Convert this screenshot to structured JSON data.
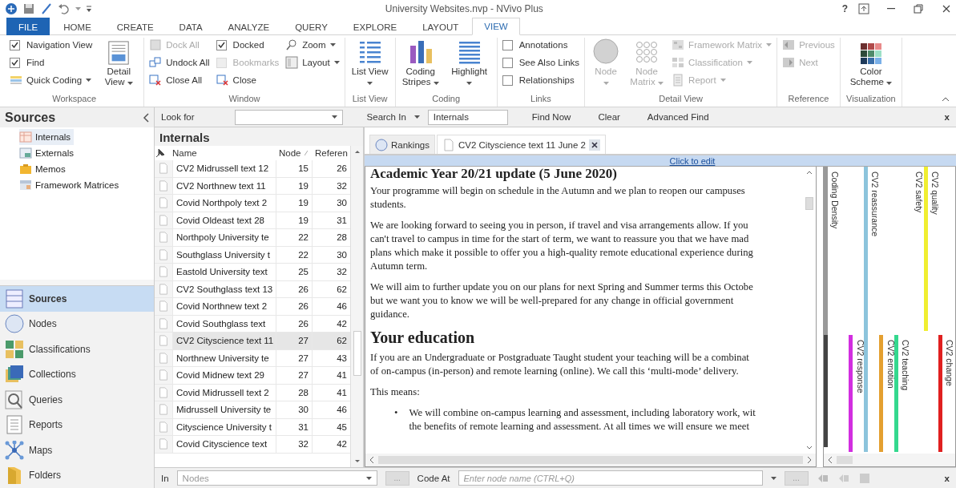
{
  "window": {
    "title": "University Websites.nvp - NVivo Plus",
    "help_button": "?"
  },
  "ribbon_tabs": [
    {
      "label": "FILE",
      "kind": "file",
      "selected": false
    },
    {
      "label": "HOME",
      "kind": "tab",
      "selected": false
    },
    {
      "label": "CREATE",
      "kind": "tab",
      "selected": false
    },
    {
      "label": "DATA",
      "kind": "tab",
      "selected": false
    },
    {
      "label": "ANALYZE",
      "kind": "tab",
      "selected": false
    },
    {
      "label": "QUERY",
      "kind": "tab",
      "selected": false
    },
    {
      "label": "EXPLORE",
      "kind": "tab",
      "selected": false
    },
    {
      "label": "LAYOUT",
      "kind": "tab",
      "selected": false
    },
    {
      "label": "VIEW",
      "kind": "tab",
      "selected": true
    }
  ],
  "ribbon_groups": [
    {
      "label": "Workspace",
      "columns": [
        [
          {
            "kind": "check",
            "label": "Navigation View",
            "checked": true,
            "disabled": false
          },
          {
            "kind": "check",
            "label": "Find",
            "checked": true,
            "disabled": false
          },
          {
            "kind": "small",
            "label": "Quick Coding",
            "dropdown": true,
            "disabled": false
          }
        ],
        [
          {
            "kind": "large",
            "label": "Detail View",
            "dropdown": true,
            "disabled": false
          }
        ]
      ]
    },
    {
      "label": "Window",
      "columns": [
        [
          {
            "kind": "small",
            "label": "Dock All",
            "dropdown": false,
            "disabled": true
          },
          {
            "kind": "small",
            "label": "Undock All",
            "dropdown": false,
            "disabled": false
          },
          {
            "kind": "small",
            "label": "Close All",
            "dropdown": false,
            "disabled": false
          }
        ],
        [
          {
            "kind": "check",
            "label": "Docked",
            "checked": true,
            "disabled": false
          },
          {
            "kind": "check",
            "label": "Bookmarks",
            "checked": false,
            "disabled": true
          },
          {
            "kind": "small",
            "label": "Close",
            "dropdown": false,
            "disabled": false
          }
        ],
        [
          {
            "kind": "small",
            "label": "Zoom",
            "dropdown": true,
            "disabled": false
          },
          {
            "kind": "small",
            "label": "Layout",
            "dropdown": true,
            "disabled": false
          }
        ]
      ]
    },
    {
      "label": "List View",
      "columns": [
        [
          {
            "kind": "large",
            "label": "List View",
            "dropdown": true,
            "disabled": false
          }
        ]
      ]
    },
    {
      "label": "Coding",
      "columns": [
        [
          {
            "kind": "large",
            "label": "Coding Stripes",
            "dropdown": true,
            "disabled": false
          }
        ],
        [
          {
            "kind": "large",
            "label": "Highlight",
            "dropdown": true,
            "disabled": false
          }
        ]
      ]
    },
    {
      "label": "Links",
      "columns": [
        [
          {
            "kind": "check",
            "label": "Annotations",
            "checked": false,
            "disabled": false
          },
          {
            "kind": "check",
            "label": "See Also Links",
            "checked": false,
            "disabled": false
          },
          {
            "kind": "check",
            "label": "Relationships",
            "checked": false,
            "disabled": false
          }
        ]
      ]
    },
    {
      "label": "Detail View",
      "columns": [
        [
          {
            "kind": "large",
            "label": "Node",
            "dropdown": true,
            "disabled": true
          }
        ],
        [
          {
            "kind": "large",
            "label": "Node Matrix",
            "dropdown": true,
            "disabled": true
          }
        ],
        [
          {
            "kind": "small",
            "label": "Framework Matrix",
            "dropdown": true,
            "disabled": true
          },
          {
            "kind": "small",
            "label": "Classification",
            "dropdown": true,
            "disabled": true
          },
          {
            "kind": "small",
            "label": "Report",
            "dropdown": true,
            "disabled": true
          }
        ]
      ]
    },
    {
      "label": "Reference",
      "columns": [
        [
          {
            "kind": "small",
            "label": "Previous",
            "dropdown": false,
            "disabled": true
          },
          {
            "kind": "small",
            "label": "Next",
            "dropdown": false,
            "disabled": true
          }
        ]
      ]
    },
    {
      "label": "Visualization",
      "columns": [
        [
          {
            "kind": "large",
            "label": "Color Scheme",
            "dropdown": true,
            "disabled": false
          }
        ]
      ]
    }
  ],
  "navigation": {
    "title": "Sources",
    "tree": [
      {
        "label": "Internals",
        "selected": true
      },
      {
        "label": "Externals",
        "selected": false
      },
      {
        "label": "Memos",
        "selected": false
      },
      {
        "label": "Framework Matrices",
        "selected": false
      }
    ],
    "buttons": [
      {
        "label": "Sources",
        "selected": true
      },
      {
        "label": "Nodes",
        "selected": false
      },
      {
        "label": "Classifications",
        "selected": false
      },
      {
        "label": "Collections",
        "selected": false
      },
      {
        "label": "Queries",
        "selected": false
      },
      {
        "label": "Reports",
        "selected": false
      },
      {
        "label": "Maps",
        "selected": false
      },
      {
        "label": "Folders",
        "selected": false
      }
    ]
  },
  "find_bar": {
    "look_for_label": "Look for",
    "search_in_label": "Search In",
    "search_in_value": "Internals",
    "find_now": "Find Now",
    "clear": "Clear",
    "advanced_find": "Advanced Find",
    "close": "x"
  },
  "list": {
    "title": "Internals",
    "columns": [
      "Name",
      "Node",
      "Referen"
    ],
    "rows": [
      {
        "name": "CV2 Midrussell text 12",
        "nodes": "15",
        "references": "26",
        "selected": false
      },
      {
        "name": "CV2 Northnew text 11",
        "nodes": "19",
        "references": "32",
        "selected": false
      },
      {
        "name": "Covid Northpoly text 2",
        "nodes": "19",
        "references": "30",
        "selected": false
      },
      {
        "name": "Covid Oldeast text 28",
        "nodes": "19",
        "references": "31",
        "selected": false
      },
      {
        "name": "Northpoly University te",
        "nodes": "22",
        "references": "28",
        "selected": false
      },
      {
        "name": "Southglass University t",
        "nodes": "22",
        "references": "30",
        "selected": false
      },
      {
        "name": "Eastold University text",
        "nodes": "25",
        "references": "32",
        "selected": false
      },
      {
        "name": "CV2 Southglass text 13",
        "nodes": "26",
        "references": "62",
        "selected": false
      },
      {
        "name": "Covid Northnew text 2",
        "nodes": "26",
        "references": "46",
        "selected": false
      },
      {
        "name": "Covid Southglass text",
        "nodes": "26",
        "references": "42",
        "selected": false
      },
      {
        "name": "CV2 Cityscience text 11",
        "nodes": "27",
        "references": "62",
        "selected": true
      },
      {
        "name": "Northnew University te",
        "nodes": "27",
        "references": "43",
        "selected": false
      },
      {
        "name": "Covid Midnew text 29",
        "nodes": "27",
        "references": "41",
        "selected": false
      },
      {
        "name": "Covid Midrussell text 2",
        "nodes": "28",
        "references": "41",
        "selected": false
      },
      {
        "name": "Midrussell University te",
        "nodes": "30",
        "references": "46",
        "selected": false
      },
      {
        "name": "Cityscience University t",
        "nodes": "31",
        "references": "45",
        "selected": false
      },
      {
        "name": "Covid Cityscience text",
        "nodes": "32",
        "references": "42",
        "selected": false
      }
    ]
  },
  "detail_tabs": [
    {
      "label": "Rankings",
      "kind": "node",
      "selected": false
    },
    {
      "label": "CV2 Cityscience text 11 June 2",
      "kind": "document",
      "selected": true
    }
  ],
  "edit_bar": {
    "link": "Click to edit"
  },
  "document": {
    "blocks": [
      {
        "kind": "h1",
        "lines": [
          "Academic Year 20/21 update (5 June 2020)"
        ]
      },
      {
        "kind": "p",
        "lines": [
          "Your programme will begin on schedule in the Autumn and we plan to reopen our campuses",
          "students."
        ]
      },
      {
        "kind": "p",
        "lines": [
          "We are looking forward to seeing you in person, if travel and visa arrangements allow. If you",
          "can't travel to campus in time for the start of term, we want to reassure you that we have mad",
          "plans which make it possible to offer you a high-quality remote educational experience during",
          "Autumn term."
        ]
      },
      {
        "kind": "p",
        "lines": [
          "We will aim to further update you on our plans for next Spring and Summer terms this Octobe",
          "but we want you to know we will be well-prepared for any change in official government",
          "guidance."
        ]
      },
      {
        "kind": "h2",
        "lines": [
          "Your education"
        ]
      },
      {
        "kind": "p",
        "lines": [
          "If you are an Undergraduate or Postgraduate Taught student your  teaching  will be a combinat",
          "of on-campus (in-person) and remote learning (online). We call this ‘multi-mode’ delivery."
        ]
      },
      {
        "kind": "p",
        "lines": [
          "This means:"
        ]
      },
      {
        "kind": "bullet",
        "marker": "•",
        "lines": [
          "We will combine on-campus learning and assessment, including laboratory work, wit",
          "the benefits of remote learning and assessment. At all times we will ensure we meet"
        ]
      }
    ]
  },
  "coding_stripes": [
    {
      "label": "Coding Density",
      "kind": "density"
    },
    {
      "label": "CV2 reassurance",
      "kind": "bar",
      "color": "#8cc4dc"
    },
    {
      "label": "CV2 safety",
      "kind": "label"
    },
    {
      "label": "CV2 quality",
      "kind": "bar",
      "color": "#f0ee30"
    },
    {
      "label": "CV2 response",
      "kind": "bar",
      "color": "#d22ee0"
    },
    {
      "label": "CV2 emotion",
      "kind": "bar",
      "color": "#e4a030"
    },
    {
      "label": "CV2 teaching",
      "kind": "bar",
      "color": "#34d88e"
    },
    {
      "label": "CV2 change",
      "kind": "bar",
      "color": "#e02020"
    }
  ],
  "code_bar": {
    "in_label": "In",
    "in_value": "Nodes",
    "browse": "...",
    "code_at_label": "Code At",
    "code_at_placeholder": "Enter node name (CTRL+Q)",
    "browse_2": "...",
    "close": "x"
  }
}
